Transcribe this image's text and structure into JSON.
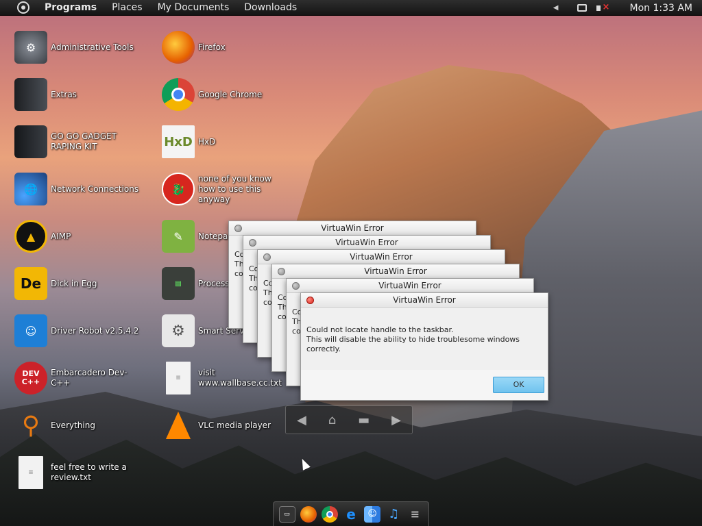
{
  "topbar": {
    "menus": [
      "Programs",
      "Places",
      "My Documents",
      "Downloads"
    ],
    "clock": "Mon 1:33 AM"
  },
  "desktop": {
    "left_column": [
      {
        "label": "Administrative Tools",
        "icon": "admin-tools-icon",
        "color": "#5b5f66"
      },
      {
        "label": "Extras",
        "icon": "folder-icon",
        "color": "#3b3f45"
      },
      {
        "label": "GO GO GADGET RAPING KIT",
        "icon": "pc-icon",
        "color": "#2c2f33"
      },
      {
        "label": "Network Connections",
        "icon": "network-icon",
        "color": "#2a72c9"
      },
      {
        "label": "AIMP",
        "icon": "aimp-icon",
        "color": "#f2b705"
      },
      {
        "label": "Dick in Egg",
        "icon": "dick-in-egg-icon",
        "color": "#e0a800"
      },
      {
        "label": "Driver Robot v2.5.4.2",
        "icon": "driver-robot-icon",
        "color": "#1e7fd6"
      },
      {
        "label": "Embarcadero Dev-C++",
        "icon": "devcpp-icon",
        "color": "#cc2229"
      },
      {
        "label": "Everything",
        "icon": "magnifier-icon",
        "color": "#e87a12"
      },
      {
        "label": "feel free to write a review.txt",
        "icon": "text-file-icon",
        "color": "#f2f2f2"
      }
    ],
    "right_column": [
      {
        "label": "Firefox",
        "icon": "firefox-icon",
        "color": "#e66000"
      },
      {
        "label": "Google Chrome",
        "icon": "chrome-icon",
        "color": "#db4437"
      },
      {
        "label": "HxD",
        "icon": "hxd-icon",
        "color": "#f4f4f4"
      },
      {
        "label": "none of you know how to use this anyway",
        "icon": "red-dragon-icon",
        "color": "#d7261e"
      },
      {
        "label": "Notepad",
        "icon": "notepad-icon",
        "color": "#7fb241"
      },
      {
        "label": "Process",
        "icon": "process-icon",
        "color": "#3a3f3a"
      },
      {
        "label": "Smart Servi",
        "icon": "smart-services-icon",
        "color": "#9a9a9a"
      },
      {
        "label": "visit www.wallbase.cc.txt",
        "icon": "text-file-icon",
        "color": "#f2f2f2"
      },
      {
        "label": "VLC media player",
        "icon": "vlc-icon",
        "color": "#ff8800"
      }
    ]
  },
  "error_windows": {
    "title": "VirtuaWin Error",
    "partial_text": "Co\nTh\nco",
    "message": "Could not locate handle to the taskbar.\n This will disable the ability to hide troublesome windows\ncorrectly.",
    "ok_label": "OK"
  },
  "navbar": {
    "icons": [
      "back-arrow-icon",
      "home-icon",
      "folder-icon",
      "forward-arrow-icon"
    ]
  },
  "dock": {
    "items": [
      "terminal-icon",
      "firefox-icon",
      "chrome-icon",
      "ie-icon",
      "finder-icon",
      "music-icon",
      "menu-icon"
    ]
  }
}
